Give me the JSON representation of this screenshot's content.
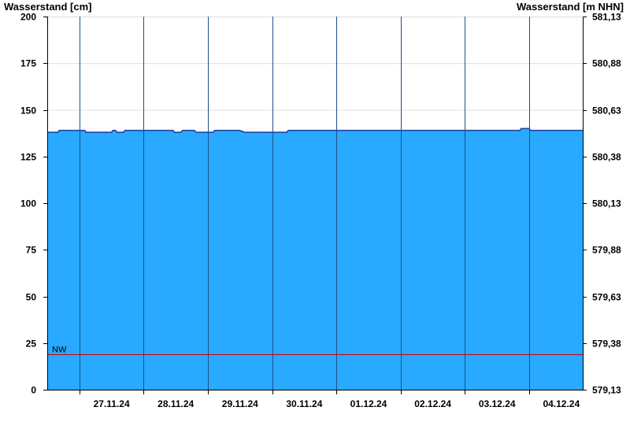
{
  "chart_data": {
    "type": "area",
    "title": "",
    "ylabel_left": "Wasserstand [cm]",
    "ylabel_right": "Wasserstand [m NHN]",
    "xlabel": "",
    "ylim": [
      0,
      200
    ],
    "yticks_left": [
      0,
      25,
      50,
      75,
      100,
      125,
      150,
      175,
      200
    ],
    "yticks_right": [
      "579,13",
      "579,38",
      "579,63",
      "579,88",
      "580,13",
      "580,38",
      "580,63",
      "580,88",
      "581,13"
    ],
    "xlim": [
      "2024-11-26T12:00",
      "2024-12-04T20:00"
    ],
    "x_tick_labels": [
      "27.11.24",
      "28.11.24",
      "29.11.24",
      "30.11.24",
      "01.12.24",
      "02.12.24",
      "03.12.24",
      "04.12.24"
    ],
    "grid": true,
    "fill_color": "#29a9ff",
    "series": [
      {
        "x": [
          "2024-11-26T12:00",
          "2024-11-26T16:00",
          "2024-11-26T16:30",
          "2024-11-27T02:00",
          "2024-11-27T02:30",
          "2024-11-27T12:00",
          "2024-11-27T12:30",
          "2024-11-27T13:30",
          "2024-11-27T14:00",
          "2024-11-27T16:30",
          "2024-11-27T17:00",
          "2024-11-28T11:00",
          "2024-11-28T11:30",
          "2024-11-28T14:00",
          "2024-11-28T14:30",
          "2024-11-28T19:00",
          "2024-11-28T19:30",
          "2024-11-29T02:00",
          "2024-11-29T02:30",
          "2024-11-29T12:00",
          "2024-11-29T12:30",
          "2024-11-29T13:00",
          "2024-11-29T13:30",
          "2024-11-30T05:30",
          "2024-11-30T06:00",
          "2024-12-03T20:30",
          "2024-12-03T21:00",
          "2024-12-04T00:00",
          "2024-12-04T00:30",
          "2024-12-04T20:00"
        ],
        "y": [
          138,
          138,
          139,
          139,
          138,
          138,
          139,
          139,
          138,
          138,
          139,
          139,
          138,
          138,
          139,
          139,
          138,
          138,
          139,
          139,
          138.5,
          138.5,
          138,
          138,
          139,
          139,
          140,
          140,
          139,
          139
        ]
      }
    ],
    "reference_lines": [
      {
        "label": "NW",
        "value": 19,
        "color": "#cc0000"
      }
    ]
  }
}
